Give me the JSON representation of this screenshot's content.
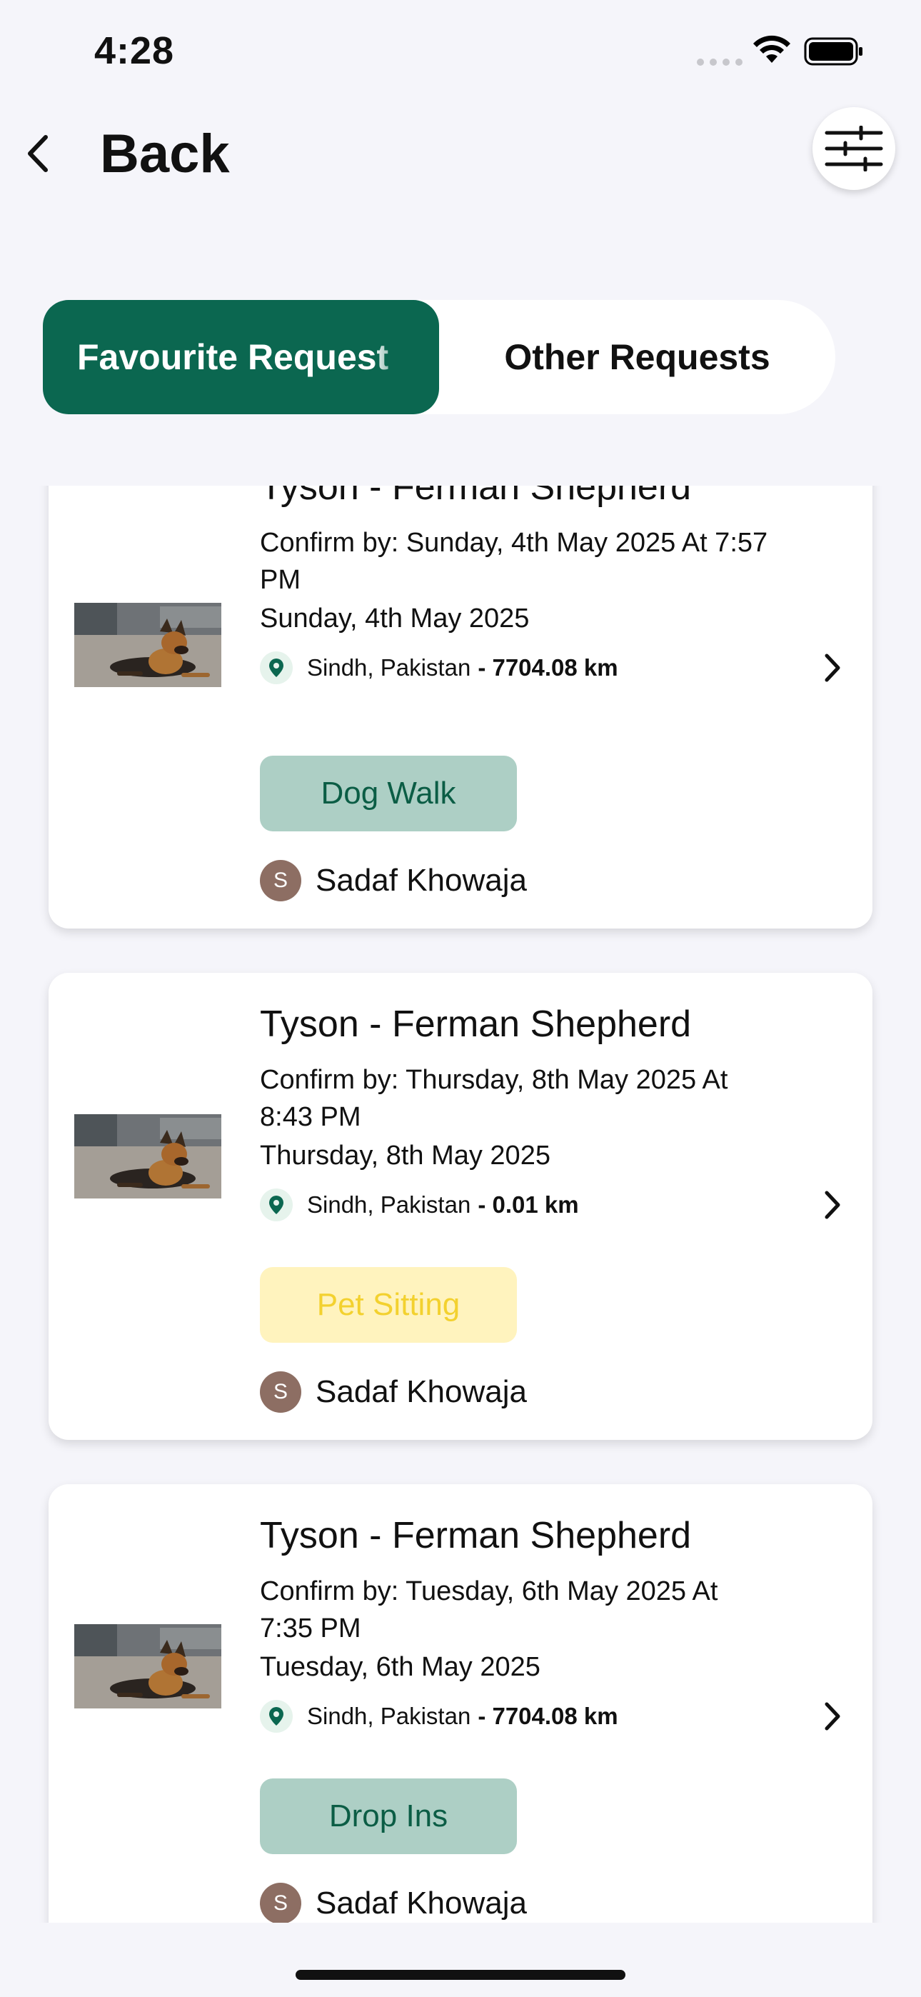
{
  "status_bar": {
    "time": "4:28"
  },
  "header": {
    "back_label": "Back"
  },
  "tabs": [
    {
      "label": "Favourite Request",
      "active": true
    },
    {
      "label": "Other Requests",
      "active": false
    }
  ],
  "requests": [
    {
      "title": "Tyson - Ferman Shepherd",
      "confirm": "Confirm by: Sunday, 4th May 2025 At 7:57 PM",
      "date": "Sunday, 4th May 2025",
      "location": "Sindh, Pakistan",
      "distance": "- 7704.08 km",
      "service": "Dog Walk",
      "owner_initial": "S",
      "owner_name": "Sadaf Khowaja"
    },
    {
      "title": "Tyson - Ferman Shepherd",
      "confirm": "Confirm by: Thursday, 8th May 2025 At 8:43 PM",
      "date": "Thursday, 8th May 2025",
      "location": "Sindh, Pakistan",
      "distance": "- 0.01 km",
      "service": "Pet Sitting",
      "owner_initial": "S",
      "owner_name": "Sadaf Khowaja"
    },
    {
      "title": "Tyson - Ferman Shepherd",
      "confirm": "Confirm by: Tuesday, 6th May 2025 At 7:35 PM",
      "date": "Tuesday, 6th May 2025",
      "location": "Sindh, Pakistan",
      "distance": "- 7704.08 km",
      "service": "Drop Ins",
      "owner_initial": "S",
      "owner_name": "Sadaf Khowaja"
    }
  ],
  "colors": {
    "primary": "#0B6750",
    "background": "#F5F5FA",
    "pill_green_bg": "#ADCFC5",
    "pill_yellow_bg": "#FFF3BE",
    "pill_yellow_text": "#F3D12F",
    "avatar": "#8D6E63"
  }
}
